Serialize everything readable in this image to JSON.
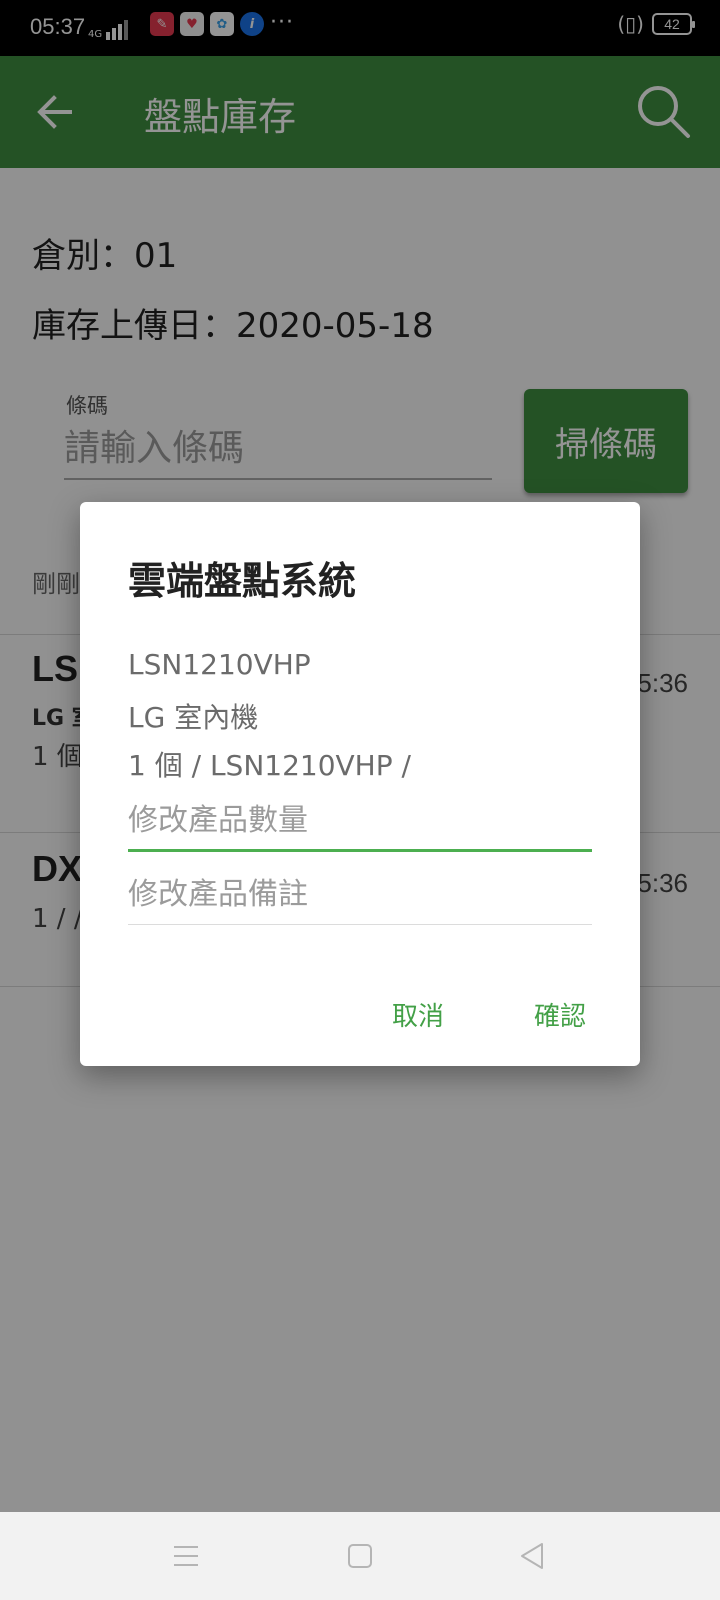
{
  "status_bar": {
    "time": "05:37",
    "network": "4G",
    "battery": "42",
    "more": "···",
    "apps": [
      {
        "icon": "pinterest-like-app-icon",
        "glyph": "✎",
        "color": "#e53950"
      },
      {
        "icon": "heart-app-icon",
        "glyph": "♥",
        "color": "#f5f5f5"
      },
      {
        "icon": "pinwheel-app-icon",
        "glyph": "✿",
        "color": "#ffffff"
      },
      {
        "icon": "info-app-icon",
        "glyph": "i",
        "color": "#1a73e8"
      }
    ]
  },
  "app_bar": {
    "title": "盤點庫存",
    "color": "#3e8e41"
  },
  "main": {
    "warehouse_line": "倉別：01",
    "upload_date_line": "庫存上傳日：2020-05-18",
    "barcode_label": "條碼",
    "barcode_placeholder": "請輸入條碼",
    "scan_button": "掃條碼",
    "recent_label": "剛剛",
    "items": [
      {
        "code": "LS",
        "name": "LG 室",
        "qty": "1 個",
        "time": "5:36"
      },
      {
        "code": "DX",
        "qty": "1 / /",
        "time": "5:36"
      }
    ]
  },
  "dialog": {
    "title": "雲端盤點系統",
    "line1": "LSN1210VHP",
    "line2": "LG 室內機",
    "line3": "1 個 / LSN1210VHP /",
    "qty_placeholder": "修改產品數量",
    "note_placeholder": "修改產品備註",
    "cancel": "取消",
    "confirm": "確認",
    "accent": "#43a047"
  },
  "nav_bar": {
    "items": [
      "menu-icon",
      "home-square-icon",
      "back-triangle-icon"
    ]
  }
}
